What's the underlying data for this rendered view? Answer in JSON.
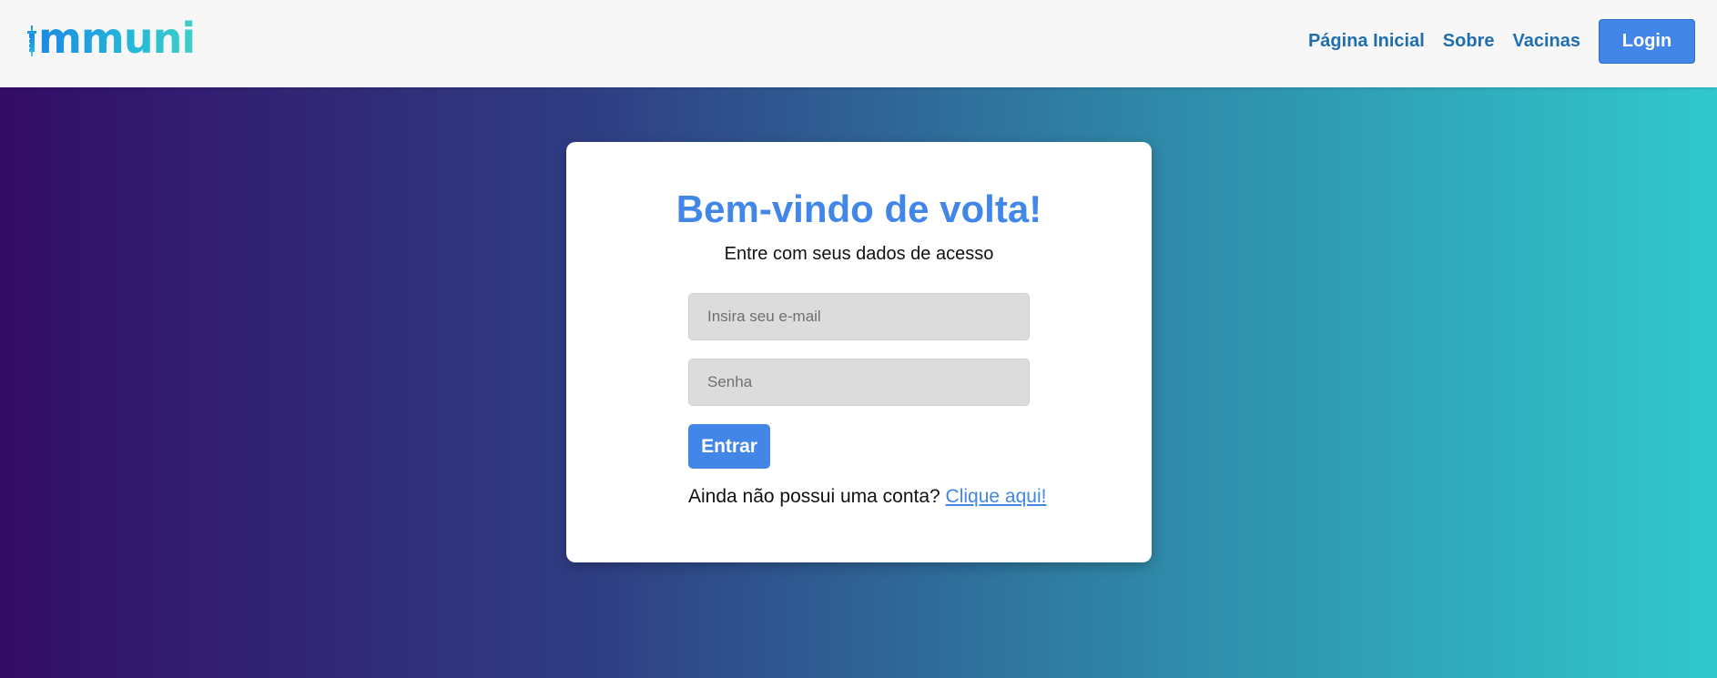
{
  "header": {
    "logo_text": "mmuni",
    "logo_icon": "syringe-icon",
    "nav": {
      "home": "Página Inicial",
      "about": "Sobre",
      "vaccines": "Vacinas",
      "login": "Login"
    }
  },
  "login_card": {
    "title": "Bem-vindo de volta!",
    "subtitle": "Entre com seus dados de acesso",
    "email_placeholder": "Insira seu e-mail",
    "password_placeholder": "Senha",
    "submit_label": "Entrar",
    "signup_prompt": "Ainda não possui uma conta?",
    "signup_link": "Clique aqui!"
  },
  "colors": {
    "accent": "#4287e8",
    "nav_link": "#1f6fb0",
    "gradient_start": "#330d66",
    "gradient_end": "#30c8cc"
  }
}
